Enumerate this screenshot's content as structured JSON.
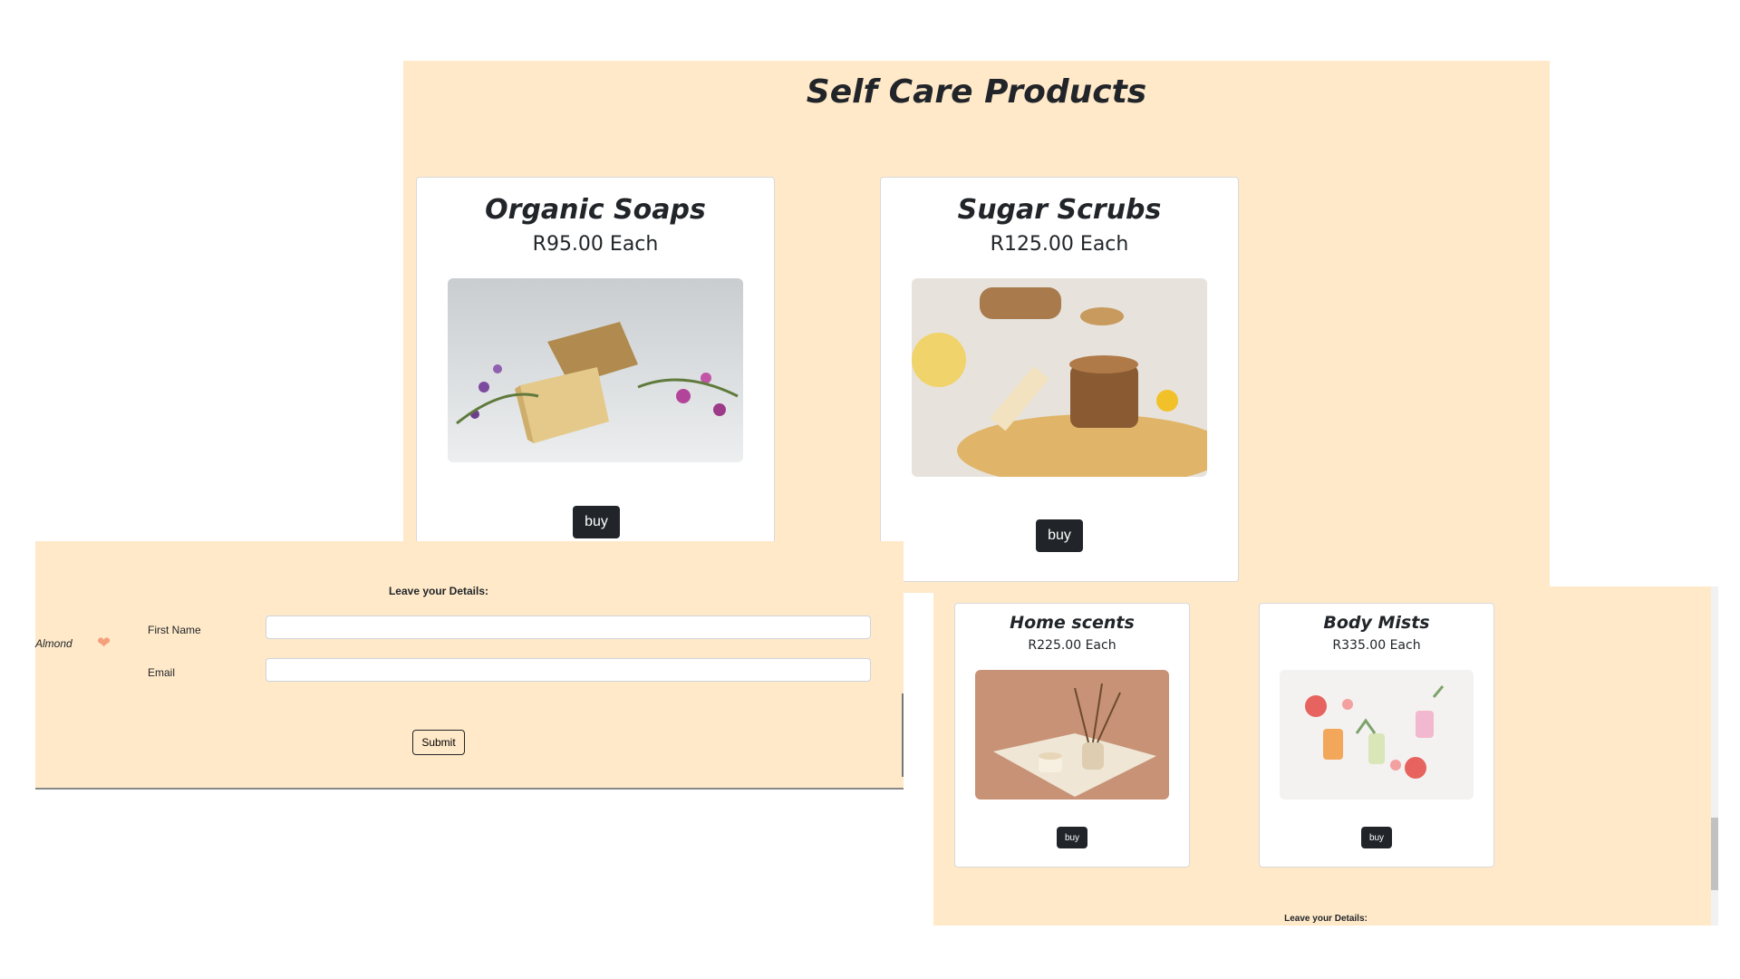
{
  "main": {
    "title": "Self Care Products",
    "products": [
      {
        "name": "Organic Soaps",
        "price": "R95.00 Each",
        "buy_label": "buy"
      },
      {
        "name": "Sugar Scrubs",
        "price": "R125.00 Each",
        "buy_label": "buy"
      }
    ]
  },
  "secondary": {
    "products": [
      {
        "name": "Home scents",
        "price": "R225.00 Each",
        "buy_label": "buy"
      },
      {
        "name": "Body Mists",
        "price": "R335.00 Each",
        "buy_label": "buy"
      }
    ],
    "footer_title": "Leave your Details:"
  },
  "form": {
    "title": "Leave your Details:",
    "brand_text": "Almond",
    "first_name_label": "First Name",
    "first_name_value": "",
    "email_label": "Email",
    "email_value": "",
    "submit_label": "Submit"
  },
  "colors": {
    "panel_bg": "#ffe9c9",
    "button_dark": "#212529",
    "heart": "#f4a07c"
  }
}
